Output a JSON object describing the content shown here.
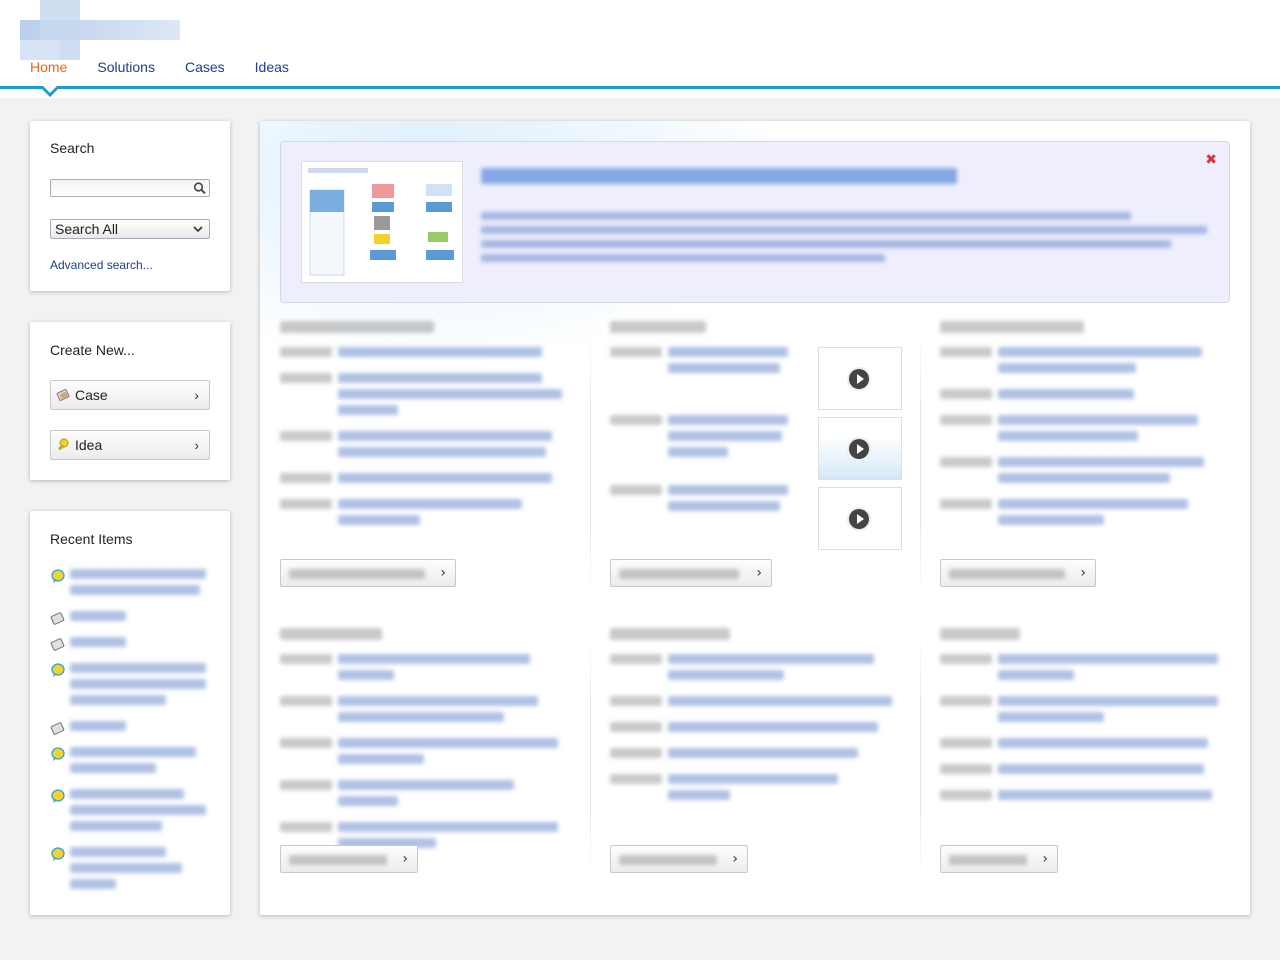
{
  "nav": {
    "tabs": [
      {
        "label": "Home",
        "active": true
      },
      {
        "label": "Solutions",
        "active": false
      },
      {
        "label": "Cases",
        "active": false
      },
      {
        "label": "Ideas",
        "active": false
      }
    ]
  },
  "search": {
    "title": "Search",
    "input_value": "",
    "scope_selected": "Search All",
    "advanced_link": "Advanced search..."
  },
  "create": {
    "title": "Create New...",
    "buttons": [
      {
        "label": "Case",
        "icon": "case-icon"
      },
      {
        "label": "Idea",
        "icon": "idea-icon"
      }
    ]
  },
  "recent": {
    "title": "Recent Items"
  },
  "colors": {
    "accent": "#1a9bd1",
    "active_tab": "#e8641b",
    "link": "#1b3f8f",
    "close": "#dd3333"
  }
}
